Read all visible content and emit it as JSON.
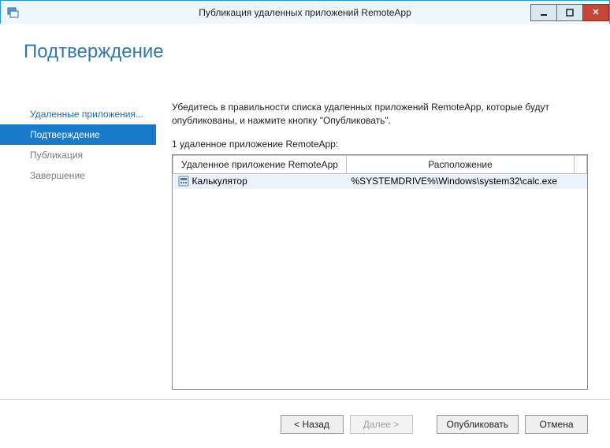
{
  "window": {
    "title": "Публикация удаленных приложений RemoteApp"
  },
  "header": {
    "title": "Подтверждение"
  },
  "sidebar": {
    "steps": [
      {
        "label": "Удаленные приложения..."
      },
      {
        "label": "Подтверждение"
      },
      {
        "label": "Публикация"
      },
      {
        "label": "Завершение"
      }
    ]
  },
  "main": {
    "instruction": "Убедитесь в правильности списка удаленных приложений RemoteApp, которые будут опубликованы, и нажмите кнопку \"Опубликовать\".",
    "listLabel": "1 удаленное приложение RemoteApp:",
    "columns": {
      "name": "Удаленное приложение RemoteApp",
      "location": "Расположение"
    },
    "rows": [
      {
        "name": "Калькулятор",
        "location": "%SYSTEMDRIVE%\\Windows\\system32\\calc.exe"
      }
    ]
  },
  "footer": {
    "back": "< Назад",
    "next": "Далее >",
    "publish": "Опубликовать",
    "cancel": "Отмена"
  }
}
